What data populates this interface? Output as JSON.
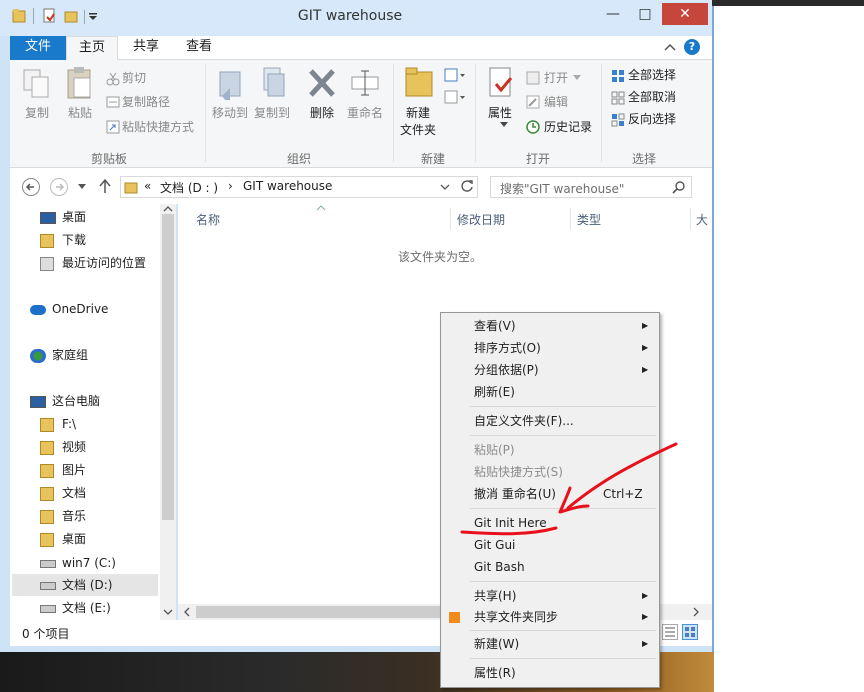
{
  "window": {
    "title": "GIT warehouse",
    "minimize": "—",
    "maximize": "□",
    "close": "✕"
  },
  "ribbon_tabs": {
    "file": "文件",
    "home": "主页",
    "share": "共享",
    "view": "查看",
    "help": "?"
  },
  "clipboard": {
    "copy": "复制",
    "paste": "粘贴",
    "cut": "剪切",
    "copy_path": "复制路径",
    "paste_shortcut": "粘贴快捷方式",
    "group": "剪贴板"
  },
  "organize": {
    "move_to": "移动到",
    "copy_to": "复制到",
    "delete": "删除",
    "rename": "重命名",
    "group": "组织"
  },
  "new_group": {
    "new_folder_line1": "新建",
    "new_folder_line2": "文件夹",
    "group": "新建"
  },
  "open_group": {
    "properties": "属性",
    "open": "打开",
    "edit": "编辑",
    "history": "历史记录",
    "group": "打开"
  },
  "select_group": {
    "select_all": "全部选择",
    "select_none": "全部取消",
    "invert": "反向选择",
    "group": "选择"
  },
  "address": {
    "prefix": "«",
    "drive": "文档 (D : )",
    "separator": "›",
    "folder": "GIT warehouse",
    "search_placeholder": "搜索\"GIT warehouse\""
  },
  "nav": {
    "items": [
      {
        "label": "桌面",
        "icon": "desktop-icon"
      },
      {
        "label": "下载",
        "icon": "download-folder-icon"
      },
      {
        "label": "最近访问的位置",
        "icon": "recent-places-icon"
      },
      {
        "label": "OneDrive",
        "icon": "onedrive-icon"
      },
      {
        "label": "家庭组",
        "icon": "homegroup-icon"
      },
      {
        "label": "这台电脑",
        "icon": "computer-icon"
      },
      {
        "label": "F:\\",
        "icon": "folder-icon"
      },
      {
        "label": "视频",
        "icon": "videos-folder-icon"
      },
      {
        "label": "图片",
        "icon": "pictures-folder-icon"
      },
      {
        "label": "文档",
        "icon": "documents-folder-icon"
      },
      {
        "label": "音乐",
        "icon": "music-folder-icon"
      },
      {
        "label": "桌面",
        "icon": "desktop-folder-icon"
      },
      {
        "label": "win7 (C:)",
        "icon": "drive-icon"
      },
      {
        "label": "文档 (D:)",
        "icon": "drive-icon"
      },
      {
        "label": "文档 (E:)",
        "icon": "drive-icon"
      }
    ]
  },
  "columns": {
    "name": "名称",
    "modified": "修改日期",
    "type": "类型",
    "size": "大"
  },
  "content": {
    "empty_message": "该文件夹为空。"
  },
  "status": {
    "count": "0 个项目"
  },
  "context_menu": {
    "view": "查看(V)",
    "sort": "排序方式(O)",
    "group_by": "分组依据(P)",
    "refresh": "刷新(E)",
    "customize": "自定义文件夹(F)...",
    "paste": "粘贴(P)",
    "paste_shortcut": "粘贴快捷方式(S)",
    "undo": "撤消 重命名(U)",
    "undo_shortcut": "Ctrl+Z",
    "git_init": "Git Init Here",
    "git_gui": "Git Gui",
    "git_bash": "Git Bash",
    "share": "共享(H)",
    "sync": "共享文件夹同步",
    "new": "新建(W)",
    "properties": "属性(R)"
  },
  "colors": {
    "accent": "#1979ca",
    "annotation": "#e8101a"
  }
}
